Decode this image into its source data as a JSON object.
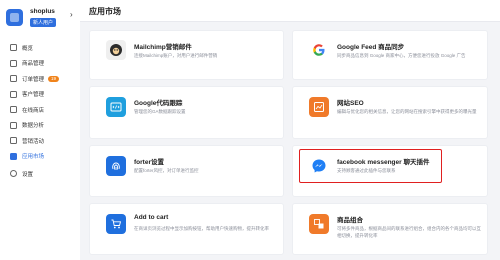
{
  "brand": {
    "shop_name": "shoplus",
    "badge": "新人用户"
  },
  "sidebar": {
    "items": [
      {
        "label": "概览",
        "icon": "dashboard-icon"
      },
      {
        "label": "商品管理",
        "icon": "box-icon"
      },
      {
        "label": "订单管理",
        "icon": "order-icon",
        "badge": "19"
      },
      {
        "label": "客户管理",
        "icon": "user-icon"
      },
      {
        "label": "在线商店",
        "icon": "store-icon"
      },
      {
        "label": "数据分析",
        "icon": "chart-icon"
      },
      {
        "label": "营销活动",
        "icon": "megaphone-icon"
      },
      {
        "label": "应用市场",
        "icon": "apps-icon"
      },
      {
        "label": "设置",
        "icon": "gear-icon"
      }
    ],
    "active_index": 7
  },
  "header": {
    "title": "应用市场"
  },
  "apps": [
    {
      "name": "Mailchimp营销邮件",
      "desc": "连接Mailchimp账户，对用户进行邮件营销",
      "icon": "mailchimp-icon",
      "color": "#f2f2f2"
    },
    {
      "name": "Google Feed 商品同步",
      "desc": "同步商品信息到 Google 商家中心，方便您进行投放 Google 广告",
      "icon": "google-icon",
      "color": "#ffffff"
    },
    {
      "name": "Google代码跟踪",
      "desc": "管理您的GA数据跟踪设置",
      "icon": "code-icon",
      "color": "#1f9fde"
    },
    {
      "name": "网站SEO",
      "desc": "编辑与优化您的相关信息，让您的网站在搜索引擎中获得更多的曝光量",
      "icon": "seo-icon",
      "color": "#f07a2a"
    },
    {
      "name": "forter设置",
      "desc": "配置forter风控，对订单进行监控",
      "icon": "fingerprint-icon",
      "color": "#1f6fde"
    },
    {
      "name": "facebook messenger 聊天插件",
      "desc": "支持顾客通过此插件与您联系",
      "icon": "messenger-icon",
      "color": "#ffffff"
    },
    {
      "name": "Add to cart",
      "desc": "在商详页浏览过程中显示加购按钮，帮助用户快速购物，提升转化率",
      "icon": "cart-icon",
      "color": "#1f6fde"
    },
    {
      "name": "商品组合",
      "desc": "可将多件商品，根据商品间的联系进行组合，组合内的各个商品均可以互相切换，提升转化率",
      "icon": "bundle-icon",
      "color": "#f07a2a"
    }
  ]
}
